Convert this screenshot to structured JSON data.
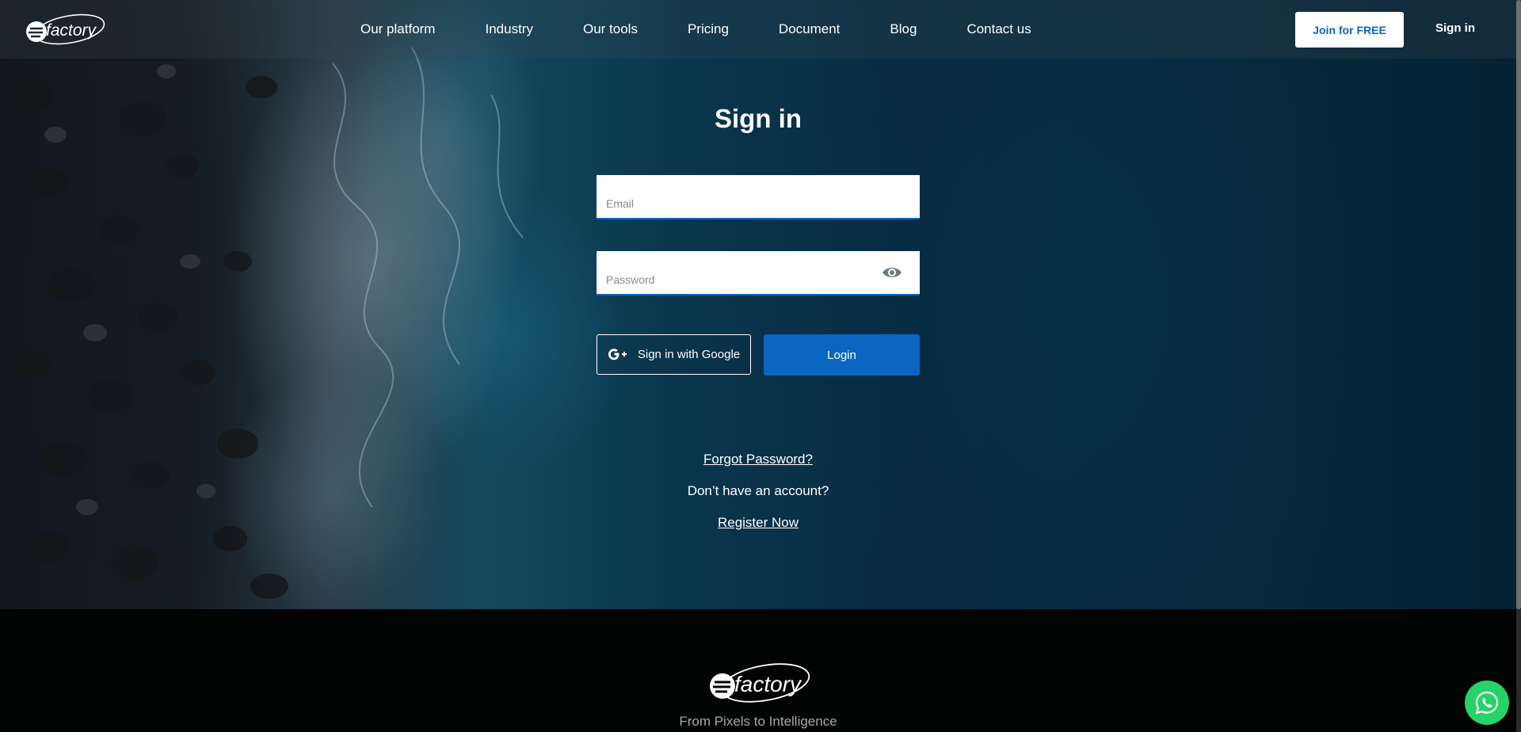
{
  "brand": {
    "logo_icon": "efactory-logo",
    "accent_color": "#0a66c2",
    "whatsapp_color": "#25d366"
  },
  "nav": {
    "links": [
      "Our platform",
      "Industry",
      "Our tools",
      "Pricing",
      "Document",
      "Blog",
      "Contact us"
    ],
    "join_label": "Join for FREE",
    "signin_label": "Sign in"
  },
  "form": {
    "title": "Sign in",
    "email_placeholder": "Email",
    "email_value": "",
    "password_placeholder": "Password",
    "password_value": "",
    "password_toggle_icon": "eye-icon",
    "google_label": "Sign in with Google",
    "google_icon": "google-plus-icon",
    "login_label": "Login",
    "forgot_label": "Forgot Password?",
    "no_account_label": "Don’t have an account?",
    "register_label": "Register Now"
  },
  "footer": {
    "tagline": "From Pixels to Intelligence"
  },
  "floating": {
    "whatsapp_icon": "whatsapp-icon"
  }
}
